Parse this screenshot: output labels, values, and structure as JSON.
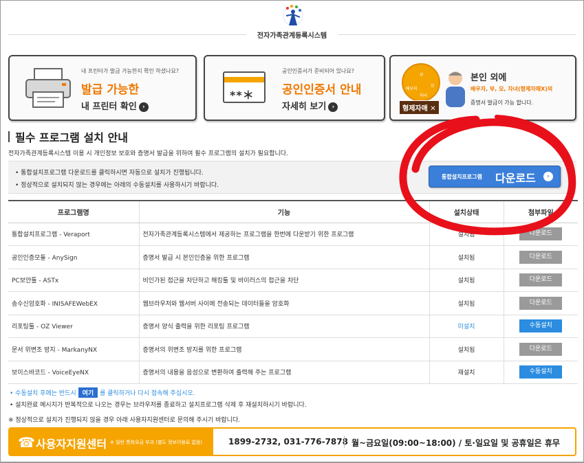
{
  "header": {
    "title": "전자가족관계등록시스템"
  },
  "cards": [
    {
      "small": "내 프린터가 발급 가능한지 확인 하셨나요?",
      "big": "발급 가능한",
      "mid": "내 프린터 확인"
    },
    {
      "small": "공인인증서가 준비되어 있나요?",
      "big": "공인인증서 안내",
      "mid": "자세히 보기",
      "cert_text": "**＊"
    },
    {
      "line1": "본인 외에",
      "line2_prefix": "배우자, 부, 모, 자녀(형제자매X)의",
      "line3": "증명서 발급이 가능 합니다.",
      "badge": "형제자매 ✕",
      "circle_labels": [
        "배우자",
        "부",
        "모",
        "자녀"
      ]
    }
  ],
  "section": {
    "title": "필수 프로그램 설치 안내",
    "desc": "전자가족관계등록시스템 이용 시 개인정보 보호와 증명서 발급을 위하여 필수 프로그램의 설치가 필요합니다.",
    "bullets": [
      "• 통합설치프로그램 다운로드를 클릭하시면 자동으로 설치가 진행됩니다.",
      "• 정상적으로 설치되지 않는 경우에는 아래의 수동설치를 사용하시기 바랍니다."
    ],
    "download_small": "통합설치프로그램",
    "download_big": "다운로드"
  },
  "table": {
    "headers": [
      "프로그램명",
      "기능",
      "설치상태",
      "첨부파일"
    ],
    "rows": [
      {
        "name": "통합설치프로그램 - Veraport",
        "desc": "전자가족관계등록시스템에서 제공하는 프로그램을 한번에 다운받기 위한 프로그램",
        "status": "설치됨",
        "action": "다운로드",
        "kind": "gray"
      },
      {
        "name": "공인인증모듈 - AnySign",
        "desc": "증명서 발급 시 본인인증을 위한 프로그램",
        "status": "설치됨",
        "action": "다운로드",
        "kind": "gray"
      },
      {
        "name": "PC보안툴 - ASTx",
        "desc": "비인가된 접근을 차단하고 해킹툴 및 바이러스의 접근을 차단",
        "status": "설치됨",
        "action": "다운로드",
        "kind": "gray"
      },
      {
        "name": "송수신암호화 - INISAFEWebEX",
        "desc": "웹브라우저와 웹서버 사이에 전송되는 데이터들을 암호화",
        "status": "설치됨",
        "action": "다운로드",
        "kind": "gray"
      },
      {
        "name": "리포팅툴 - OZ Viewer",
        "desc": "증명서 양식 출력을 위한 리포팅 프로그램",
        "status": "미설치",
        "action": "수동설치",
        "kind": "blue"
      },
      {
        "name": "문서 위변조 방지 - MarkanyNX",
        "desc": "증명서의 위변조 방지를 위한 프로그램",
        "status": "설치됨",
        "action": "다운로드",
        "kind": "gray"
      },
      {
        "name": "보이스바코드 - VoiceEyeNX",
        "desc": "증명서의 내용을 음성으로 변환하여 출력해 주는 프로그램",
        "status": "재설치",
        "action": "수동설치",
        "kind": "blue"
      }
    ]
  },
  "notes": {
    "n1_prefix": "• 수동설치 후에는 반드시",
    "n1_here": "여기",
    "n1_suffix": "를 클릭하거나 다시 접속해 주십시오.",
    "n2": "• 설치완료 메시지가 반복적으로 나오는 경우는 브라우저를 종료하고 설치프로그램 삭제 후 재설치하시기 바랍니다.",
    "n3": "※ 정상적으로 설치가 진행되지 않을 경우 아래 사용자지원센터로 문의해 주시기 바랍니다."
  },
  "footer": {
    "center": "사용자지원센터",
    "sub": "※ 일반 통화요금 부과 (별도 정보이용료 없음)",
    "numbers": "1899-2732, 031-776-7878",
    "hours": "월~금요일(09:00~18:00) / 토·일요일 및 공휴일은 휴무"
  },
  "colors": {
    "orange": "#f07800",
    "footer_orange": "#f5a400",
    "blue": "#3a7fd9",
    "link_blue": "#2b8ce0",
    "red_mark": "#e8101a"
  }
}
